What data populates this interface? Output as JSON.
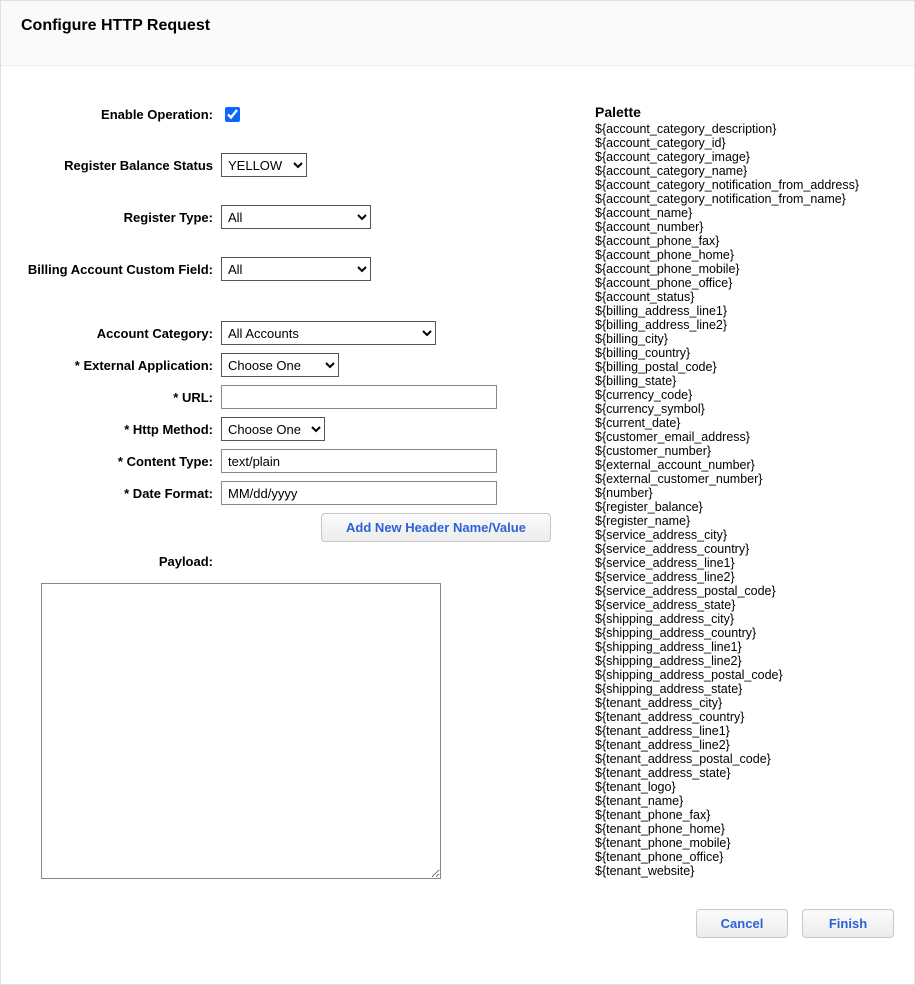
{
  "header": {
    "title": "Configure HTTP Request"
  },
  "labels": {
    "enable_operation": "Enable Operation:",
    "register_balance_status": "Register Balance Status",
    "register_type": "Register Type:",
    "billing_account_custom_field": "Billing Account Custom Field:",
    "account_category": "Account Category:",
    "external_application": "* External Application:",
    "url": "* URL:",
    "http_method": "* Http Method:",
    "content_type": "* Content Type:",
    "date_format": "* Date Format:",
    "payload": "Payload:"
  },
  "values": {
    "enable_operation": true,
    "register_balance_status": "YELLOW",
    "register_type": "All",
    "billing_account_custom_field": "All",
    "account_category": "All Accounts",
    "external_application": "Choose One",
    "url": "",
    "http_method": "Choose One",
    "content_type": "text/plain",
    "date_format": "MM/dd/yyyy",
    "payload": ""
  },
  "buttons": {
    "add_header": "Add New Header Name/Value",
    "cancel": "Cancel",
    "finish": "Finish"
  },
  "palette": {
    "title": "Palette",
    "items": [
      "${account_category_description}",
      "${account_category_id}",
      "${account_category_image}",
      "${account_category_name}",
      "${account_category_notification_from_address}",
      "${account_category_notification_from_name}",
      "${account_name}",
      "${account_number}",
      "${account_phone_fax}",
      "${account_phone_home}",
      "${account_phone_mobile}",
      "${account_phone_office}",
      "${account_status}",
      "${billing_address_line1}",
      "${billing_address_line2}",
      "${billing_city}",
      "${billing_country}",
      "${billing_postal_code}",
      "${billing_state}",
      "${currency_code}",
      "${currency_symbol}",
      "${current_date}",
      "${customer_email_address}",
      "${customer_number}",
      "${external_account_number}",
      "${external_customer_number}",
      "${number}",
      "${register_balance}",
      "${register_name}",
      "${service_address_city}",
      "${service_address_country}",
      "${service_address_line1}",
      "${service_address_line2}",
      "${service_address_postal_code}",
      "${service_address_state}",
      "${shipping_address_city}",
      "${shipping_address_country}",
      "${shipping_address_line1}",
      "${shipping_address_line2}",
      "${shipping_address_postal_code}",
      "${shipping_address_state}",
      "${tenant_address_city}",
      "${tenant_address_country}",
      "${tenant_address_line1}",
      "${tenant_address_line2}",
      "${tenant_address_postal_code}",
      "${tenant_address_state}",
      "${tenant_logo}",
      "${tenant_name}",
      "${tenant_phone_fax}",
      "${tenant_phone_home}",
      "${tenant_phone_mobile}",
      "${tenant_phone_office}",
      "${tenant_website}"
    ]
  }
}
